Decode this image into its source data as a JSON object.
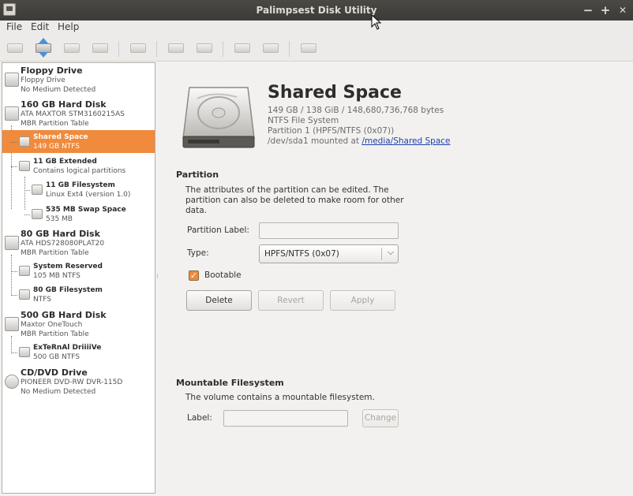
{
  "window": {
    "title": "Palimpsest Disk Utility",
    "controls": {
      "minimize": "−",
      "maximize": "+",
      "close": "✕"
    }
  },
  "menu": [
    "File",
    "Edit",
    "Help"
  ],
  "toolbar": {
    "icons": [
      "drive-mount-icon",
      "drive-eject-icon",
      "drive-unmount-icon",
      "drive-detach-icon",
      "smart-data-icon",
      "lock-volume-icon",
      "unlock-volume-icon",
      "format-drive-icon",
      "edit-partition-icon",
      "benchmark-icon"
    ]
  },
  "tree": {
    "nodes": [
      {
        "name": "Floppy Drive",
        "sub1": "Floppy Drive",
        "sub2": "No Medium Detected"
      },
      {
        "name": "160 GB Hard Disk",
        "sub1": "ATA MAXTOR STM3160215AS",
        "sub2": "MBR Partition Table"
      },
      {
        "name": "Shared Space",
        "sub1": "149 GB NTFS"
      },
      {
        "name": "11 GB Extended",
        "sub1": "Contains logical partitions"
      },
      {
        "name": "11 GB Filesystem",
        "sub1": "Linux Ext4 (version 1.0)"
      },
      {
        "name": "535 MB Swap Space",
        "sub1": "535 MB"
      },
      {
        "name": "80 GB Hard Disk",
        "sub1": "ATA HDS728080PLAT20",
        "sub2": "MBR Partition Table"
      },
      {
        "name": "System Reserved",
        "sub1": "105 MB NTFS"
      },
      {
        "name": "80 GB Filesystem",
        "sub1": "NTFS"
      },
      {
        "name": "500 GB Hard Disk",
        "sub1": "Maxtor OneTouch",
        "sub2": "MBR Partition Table"
      },
      {
        "name": "ExTeRnAl DriiiiVe",
        "sub1": "500 GB NTFS"
      },
      {
        "name": "CD/DVD Drive",
        "sub1": "PIONEER DVD-RW  DVR-115D",
        "sub2": "No Medium Detected"
      }
    ]
  },
  "volume": {
    "title": "Shared Space",
    "size_line": "149 GB / 138 GiB / 148,680,736,768 bytes",
    "fs_line": "NTFS File System",
    "partition_line": "Partition 1 (HPFS/NTFS (0x07))",
    "mount_prefix": "/dev/sda1 mounted at ",
    "mount_link": "/media/Shared Space"
  },
  "partition": {
    "heading": "Partition",
    "description": "The attributes of the partition can be edited. The partition can also be deleted to make room for other data.",
    "label_field_label": "Partition Label:",
    "label_value": "",
    "type_label": "Type:",
    "type_value": "HPFS/NTFS (0x07)",
    "bootable_label": "Bootable",
    "bootable_checked": true,
    "buttons": {
      "delete": "Delete",
      "revert": "Revert",
      "apply": "Apply"
    }
  },
  "filesystem": {
    "heading": "Mountable Filesystem",
    "description": "The volume contains a mountable filesystem.",
    "label_field_label": "Label:",
    "label_value": "",
    "change_button": "Change"
  },
  "colors": {
    "selection": "#f08a3c",
    "titlebar": "#3c3b37",
    "link": "#1f3fa8"
  }
}
